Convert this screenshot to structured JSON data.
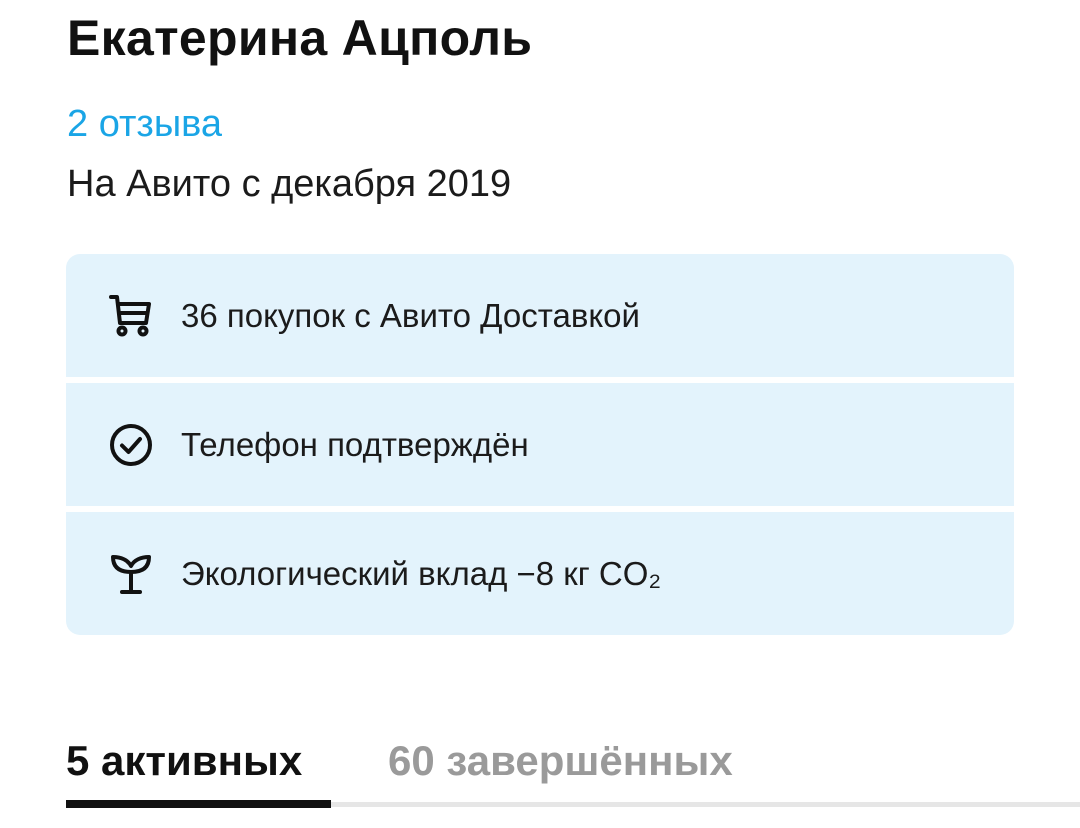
{
  "profile": {
    "name": "Екатерина Ацполь",
    "reviews_link": "2 отзыва",
    "member_since": "На Авито с декабря 2019"
  },
  "info": {
    "accent_background": "#e3f3fc",
    "items": [
      {
        "icon": "cart-icon",
        "label": "36 покупок с Авито Доставкой"
      },
      {
        "icon": "check-circle-icon",
        "label": "Телефон подтверждён"
      },
      {
        "icon": "sprout-icon",
        "label": "Экологический вклад −8 кг CO₂"
      }
    ]
  },
  "tabs": {
    "active": "5 активных",
    "inactive": "60 завершённых"
  },
  "colors": {
    "link": "#1aa5e6",
    "text": "#111111",
    "muted_tab": "#9a9a9a"
  }
}
